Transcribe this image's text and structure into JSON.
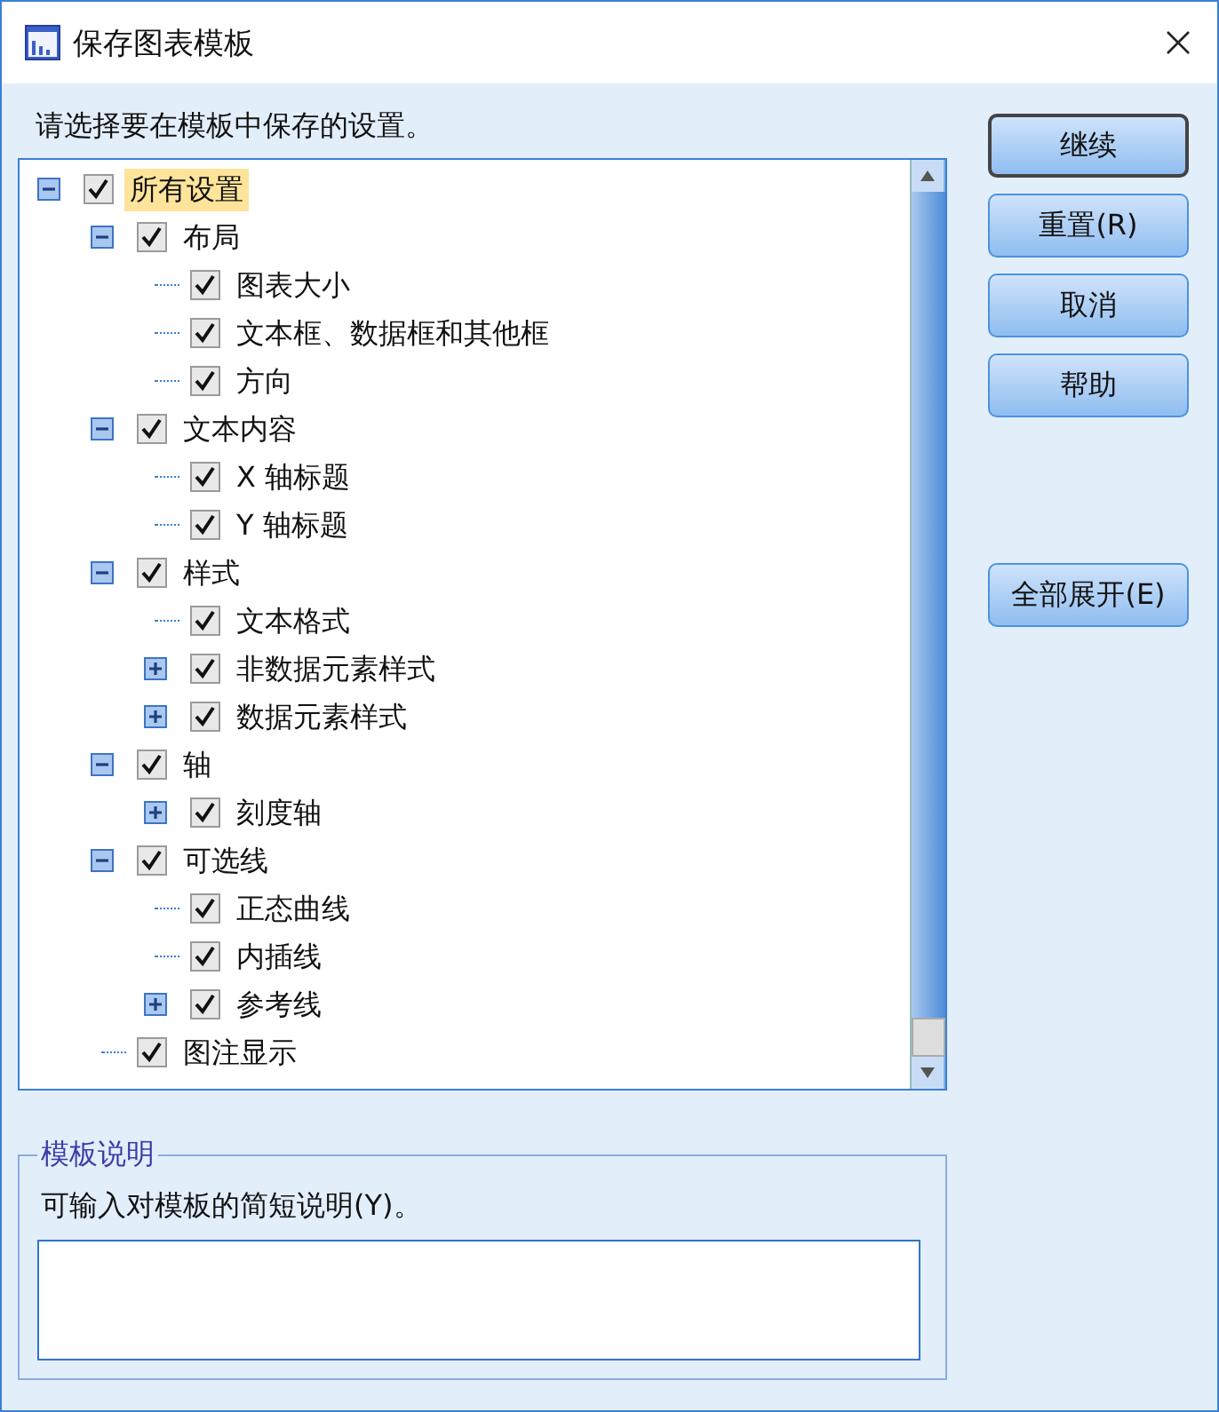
{
  "window": {
    "title": "保存图表模板"
  },
  "prompt": "请选择要在模板中保存的设置。",
  "tree": [
    {
      "label": "所有设置",
      "checked": true,
      "selected": true,
      "expanded": true,
      "children": [
        {
          "label": "布局",
          "checked": true,
          "selected": false,
          "expanded": true,
          "children": [
            {
              "label": "图表大小",
              "checked": true,
              "selected": false
            },
            {
              "label": "文本框、数据框和其他框",
              "checked": true,
              "selected": false
            },
            {
              "label": "方向",
              "checked": true,
              "selected": false
            }
          ]
        },
        {
          "label": "文本内容",
          "checked": true,
          "selected": false,
          "expanded": true,
          "children": [
            {
              "label": "X 轴标题",
              "checked": true,
              "selected": false
            },
            {
              "label": "Y 轴标题",
              "checked": true,
              "selected": false
            }
          ]
        },
        {
          "label": "样式",
          "checked": true,
          "selected": false,
          "expanded": true,
          "children": [
            {
              "label": "文本格式",
              "checked": true,
              "selected": false
            },
            {
              "label": "非数据元素样式",
              "checked": true,
              "selected": false,
              "expanded": false
            },
            {
              "label": "数据元素样式",
              "checked": true,
              "selected": false,
              "expanded": false
            }
          ]
        },
        {
          "label": "轴",
          "checked": true,
          "selected": false,
          "expanded": true,
          "children": [
            {
              "label": "刻度轴",
              "checked": true,
              "selected": false,
              "expanded": false
            }
          ]
        },
        {
          "label": "可选线",
          "checked": true,
          "selected": false,
          "expanded": true,
          "children": [
            {
              "label": "正态曲线",
              "checked": true,
              "selected": false
            },
            {
              "label": "内插线",
              "checked": true,
              "selected": false
            },
            {
              "label": "参考线",
              "checked": true,
              "selected": false,
              "expanded": false
            }
          ]
        },
        {
          "label": "图注显示",
          "checked": true,
          "selected": false
        }
      ]
    }
  ],
  "buttons": [
    {
      "label": "继续",
      "default": true
    },
    {
      "label": "重置(R)",
      "default": false
    },
    {
      "label": "取消",
      "default": false
    },
    {
      "label": "帮助",
      "default": false
    }
  ],
  "expand_all_button": "全部展开(E)",
  "description": {
    "title": "模板说明",
    "label": "可输入对模板的简短说明(Y)。"
  }
}
